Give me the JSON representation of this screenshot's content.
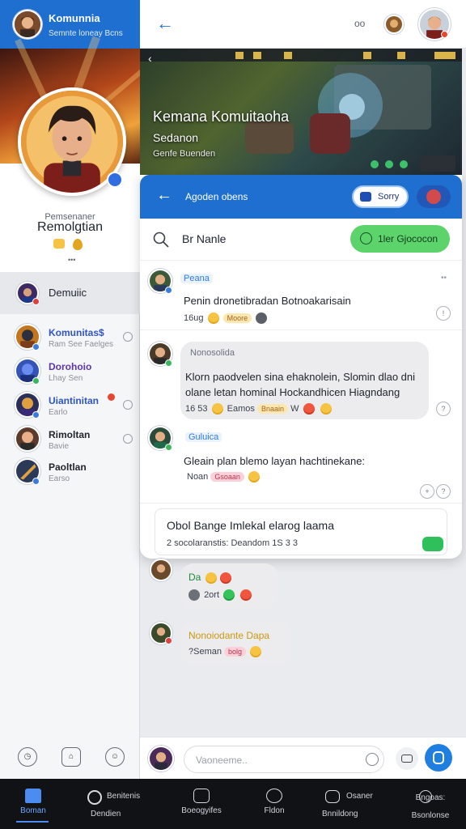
{
  "colors": {
    "primary": "#1f6fd1",
    "green": "#5dd36b",
    "bubble": "#ececee",
    "tabbar": "#101216"
  },
  "sidebar": {
    "title": "Komunnia",
    "subtitle": "Semnte loneay Bcns",
    "profile_tag": "Pemsenaner",
    "profile_name": "Remolgtian",
    "menu_item": "Demuiic",
    "channels": [
      {
        "name": "Komunitas$",
        "sub": "Ram See Faelges",
        "color": "#2f54c9"
      },
      {
        "name": "Dorohoio",
        "sub": "Lhay Sen",
        "color": "#5c36b0"
      },
      {
        "name": "Uiantinitan",
        "sub": "Earlo",
        "color": "#2f54c9"
      },
      {
        "name": "Rimoltan",
        "sub": "Bavie",
        "color": "#20252f"
      },
      {
        "name": "Paoltlan",
        "sub": "Earso",
        "color": "#20252f"
      }
    ],
    "bottom_icons": [
      "clock-icon",
      "home-outline-icon",
      "smile-icon"
    ]
  },
  "topbar": {
    "back_icon": "arrow-left-icon",
    "more": "oo"
  },
  "banner": {
    "title": "Kemana Komuitaoha",
    "subtitle": "Sedanon",
    "caption": "Genfe Buenden"
  },
  "panel": {
    "header_title": "Agoden obens",
    "header_pill": "Sorry",
    "search_label": "Br Nanle",
    "green_pill": "1ler Gjococon",
    "messages": [
      {
        "name": "Peana",
        "name_color": "#2f7de0",
        "text": "Penin dronetibradan Botnoakarisain",
        "meta": "16ug",
        "chip": "Moore"
      },
      {
        "name": "Nonosolida",
        "name_color": "#6b7280",
        "text": "Klorn paodvelen sina ehaknolein, Slomin dlao dni olane letan hominal Hockandhicen Hiagndang",
        "meta": "16 53",
        "chip_a": "Eamos",
        "chip_b": "Bnaain",
        "extra": "W"
      },
      {
        "name": "Guluica",
        "name_color": "#2f7de0",
        "text": "Gleain plan blemo layan hachtinekane:",
        "meta": "Noan",
        "chip": "Gsoaan"
      }
    ],
    "notice_title": "Obol Bange Imlekal elarog laama",
    "notice_sub": "2 socolaranstis: Deandom 1S 3 3"
  },
  "feed": [
    {
      "name": "Da",
      "line": "2ort"
    },
    {
      "name": "Nonoiodante Dapa",
      "line": "?Seman",
      "chip": "bolg"
    }
  ],
  "composer": {
    "placeholder": "Vaoneeme.."
  },
  "tabs": [
    {
      "label": "Boman",
      "icon": "home-icon"
    },
    {
      "label": "Dendien",
      "top": "Benitenis",
      "icon": "search-icon"
    },
    {
      "label": "Boeogyifes",
      "icon": "camera-icon"
    },
    {
      "label": "Fldon",
      "icon": "globe-icon"
    },
    {
      "label": "Bnnildong",
      "top": "Osaner",
      "icon": "chat-icon"
    },
    {
      "label": "Bsonlonse",
      "top": "Bngoas:",
      "icon": "settings-icon"
    }
  ]
}
